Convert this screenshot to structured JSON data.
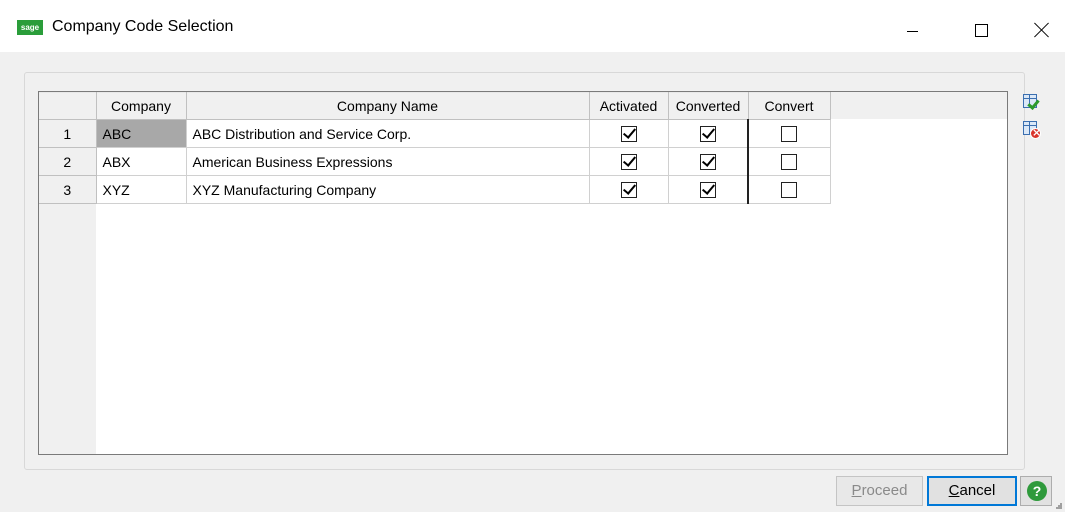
{
  "window": {
    "title": "Company Code Selection",
    "app_icon_text": "sage",
    "minimize_icon": "minimize-icon",
    "maximize_icon": "maximize-icon",
    "close_icon": "close-icon"
  },
  "grid": {
    "columns": [
      "Company",
      "Company Name",
      "Activated",
      "Converted",
      "Convert"
    ],
    "rows": [
      {
        "num": "1",
        "company": "ABC",
        "name": "ABC Distribution and Service Corp.",
        "activated": true,
        "converted": true,
        "convert": false
      },
      {
        "num": "2",
        "company": "ABX",
        "name": "American Business Expressions",
        "activated": true,
        "converted": true,
        "convert": false
      },
      {
        "num": "3",
        "company": "XYZ",
        "name": "XYZ Manufacturing Company",
        "activated": true,
        "converted": true,
        "convert": false
      }
    ]
  },
  "side_icons": [
    "select-all-icon",
    "clear-all-icon"
  ],
  "buttons": {
    "proceed": {
      "accel": "P",
      "rest": "roceed"
    },
    "cancel": {
      "accel": "C",
      "rest": "ancel"
    },
    "help_icon": "help-icon",
    "help_text": "?"
  },
  "colors": {
    "app_icon": "#2a9d3a",
    "selected_cell": "#a8a8a8",
    "focus_border": "#0078d7",
    "help": "#2f9a3c"
  }
}
